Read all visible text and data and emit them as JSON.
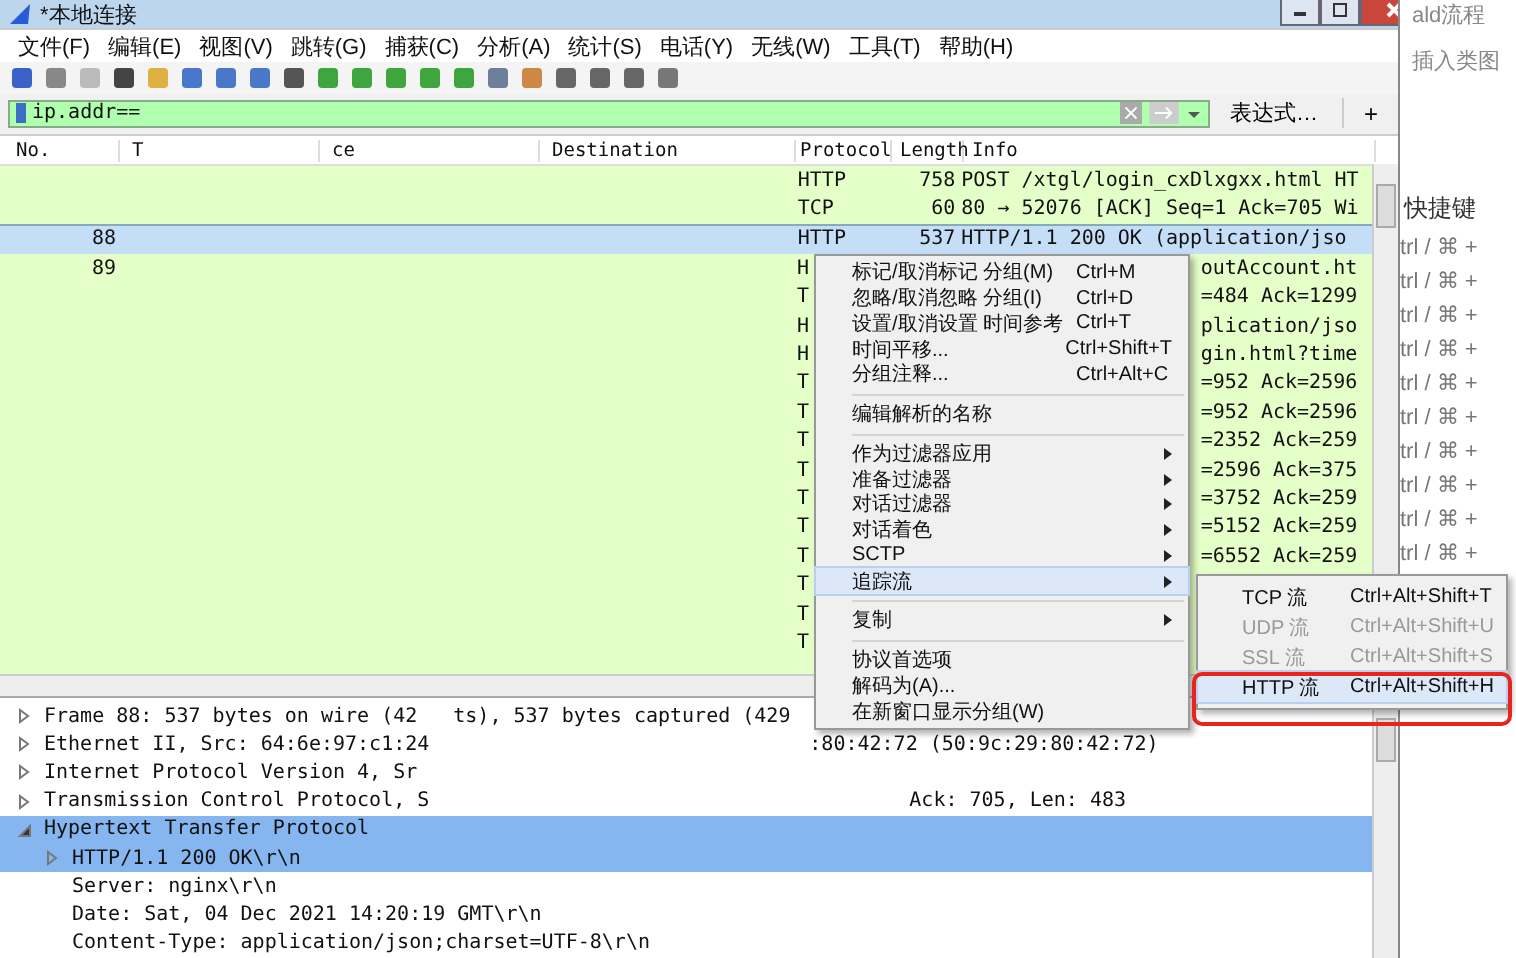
{
  "window": {
    "title": "*本地连接"
  },
  "menu_bar": [
    "文件(F)",
    "编辑(E)",
    "视图(V)",
    "跳转(G)",
    "捕获(C)",
    "分析(A)",
    "统计(S)",
    "电话(Y)",
    "无线(W)",
    "工具(T)",
    "帮助(H)"
  ],
  "filter": {
    "value": "ip.addr==",
    "expression_label": "表达式…",
    "add_label": "+"
  },
  "packet_list": {
    "columns": [
      "No.",
      "T",
      "ce",
      "Destination",
      "Protocol",
      "Length",
      "Info"
    ],
    "rows": [
      {
        "kind": "full",
        "no": "",
        "protocol": "HTTP",
        "length": "758",
        "info": "POST /xtgl/login_cxDlxgxx.html HT",
        "selected": false
      },
      {
        "kind": "full",
        "no": "",
        "protocol": "TCP",
        "length": "60",
        "info": "80 → 52076 [ACK] Seq=1 Ack=705 Wi",
        "selected": false
      },
      {
        "kind": "full",
        "no": "88",
        "protocol": "HTTP",
        "length": "537",
        "info": "HTTP/1.1 200 OK  (application/jso",
        "selected": true
      },
      {
        "kind": "covered",
        "no": "89",
        "protocol": "H",
        "info": "outAccount.ht",
        "selected": false
      },
      {
        "kind": "covered",
        "no": "",
        "protocol": "T",
        "info": "=484 Ack=1299",
        "selected": false
      },
      {
        "kind": "covered",
        "no": "",
        "protocol": "H",
        "info": "plication/jso",
        "selected": false
      },
      {
        "kind": "covered",
        "no": "",
        "protocol": "H",
        "info": "gin.html?time",
        "selected": false
      },
      {
        "kind": "covered",
        "no": "",
        "protocol": "T",
        "info": "=952 Ack=2596",
        "selected": false
      },
      {
        "kind": "covered",
        "no": "",
        "protocol": "T",
        "info": "=952 Ack=2596",
        "selected": false
      },
      {
        "kind": "covered",
        "no": "",
        "protocol": "T",
        "info": "=2352 Ack=259",
        "selected": false
      },
      {
        "kind": "covered",
        "no": "",
        "protocol": "T",
        "info": "=2596 Ack=375",
        "selected": false
      },
      {
        "kind": "covered",
        "no": "",
        "protocol": "T",
        "info": "=3752 Ack=259",
        "selected": false
      },
      {
        "kind": "covered",
        "no": "",
        "protocol": "T",
        "info": "=5152 Ack=259",
        "selected": false
      },
      {
        "kind": "covered",
        "no": "",
        "protocol": "T",
        "info": "=6552 Ack=259",
        "selected": false
      },
      {
        "kind": "covered",
        "no": "",
        "protocol": "T",
        "info": "",
        "selected": false
      },
      {
        "kind": "covered",
        "no": "",
        "protocol": "T",
        "info": "",
        "selected": false
      },
      {
        "kind": "covered",
        "no": "",
        "protocol": "T",
        "info": "",
        "selected": false
      }
    ]
  },
  "context_menu": {
    "items": [
      {
        "kind": "item",
        "label": "标记/取消标记 分组(M)",
        "shortcut": "Ctrl+M",
        "selected": false
      },
      {
        "kind": "item",
        "label": "忽略/取消忽略 分组(I)",
        "shortcut": "Ctrl+D",
        "selected": false
      },
      {
        "kind": "item",
        "label": "设置/取消设置 时间参考",
        "shortcut": "Ctrl+T",
        "selected": false
      },
      {
        "kind": "item",
        "label": "时间平移...",
        "shortcut": "Ctrl+Shift+T",
        "selected": false
      },
      {
        "kind": "item",
        "label": "分组注释...",
        "shortcut": "Ctrl+Alt+C",
        "selected": false
      },
      {
        "kind": "separator"
      },
      {
        "kind": "item",
        "label": "编辑解析的名称",
        "selected": false
      },
      {
        "kind": "separator"
      },
      {
        "kind": "submenu",
        "label": "作为过滤器应用",
        "selected": false
      },
      {
        "kind": "submenu",
        "label": "准备过滤器",
        "selected": false
      },
      {
        "kind": "submenu",
        "label": "对话过滤器",
        "selected": false
      },
      {
        "kind": "submenu",
        "label": "对话着色",
        "selected": false
      },
      {
        "kind": "submenu",
        "label": "SCTP",
        "selected": false
      },
      {
        "kind": "submenu",
        "label": "追踪流",
        "selected": true
      },
      {
        "kind": "separator"
      },
      {
        "kind": "submenu",
        "label": "复制",
        "selected": false
      },
      {
        "kind": "separator"
      },
      {
        "kind": "item",
        "label": "协议首选项",
        "selected": false
      },
      {
        "kind": "item",
        "label": "解码为(A)...",
        "selected": false
      },
      {
        "kind": "item",
        "label": "在新窗口显示分组(W)",
        "selected": false
      }
    ]
  },
  "submenu": {
    "items": [
      {
        "label": "TCP 流",
        "shortcut": "Ctrl+Alt+Shift+T",
        "disabled": false,
        "selected": false
      },
      {
        "label": "UDP 流",
        "shortcut": "Ctrl+Alt+Shift+U",
        "disabled": true,
        "selected": false
      },
      {
        "label": "SSL 流",
        "shortcut": "Ctrl+Alt+Shift+S",
        "disabled": true,
        "selected": false
      },
      {
        "label": "HTTP 流",
        "shortcut": "Ctrl+Alt+Shift+H",
        "disabled": false,
        "selected": true
      }
    ]
  },
  "details": [
    {
      "parts": [
        "Frame 88: 537 bytes on wire (42",
        "ts), 537 bytes captured (429"
      ],
      "expanded": false,
      "selected": false
    },
    {
      "parts": [
        "Ethernet II, Src: 64:6e:97:c1:24",
        ":80:42:72 (50:9c:29:80:42:72)"
      ],
      "expanded": false,
      "selected": false
    },
    {
      "parts": [
        "Internet Protocol Version 4, Sr"
      ],
      "expanded": false,
      "selected": false
    },
    {
      "parts": [
        "Transmission Control Protocol, S",
        "Ack: 705, Len: 483"
      ],
      "expanded": false,
      "selected": false
    },
    {
      "parts": [
        "Hypertext Transfer Protocol"
      ],
      "expanded": true,
      "selected": true,
      "children": [
        {
          "parts": [
            "HTTP/1.1 200 OK\\r\\n"
          ],
          "expanded": false,
          "selected": true,
          "expandable": true
        },
        {
          "parts": [
            "Server: nginx\\r\\n"
          ],
          "selected": false
        },
        {
          "parts": [
            "Date: Sat, 04 Dec 2021 14:20:19 GMT\\r\\n"
          ],
          "selected": false
        },
        {
          "parts": [
            "Content-Type: application/json;charset=UTF-8\\r\\n"
          ],
          "selected": false
        }
      ]
    }
  ],
  "background_page": {
    "texts": [
      "ald流程",
      "插入类图",
      "快捷键"
    ],
    "shortcut_rows": [
      "trl / ⌘ +",
      "trl / ⌘ +",
      "trl / ⌘ +",
      "trl / ⌘ +",
      "trl / ⌘ +",
      "trl / ⌘ +",
      "trl / ⌘ +",
      "trl / ⌘ +",
      "trl / ⌘ +",
      "trl / ⌘ +"
    ]
  }
}
